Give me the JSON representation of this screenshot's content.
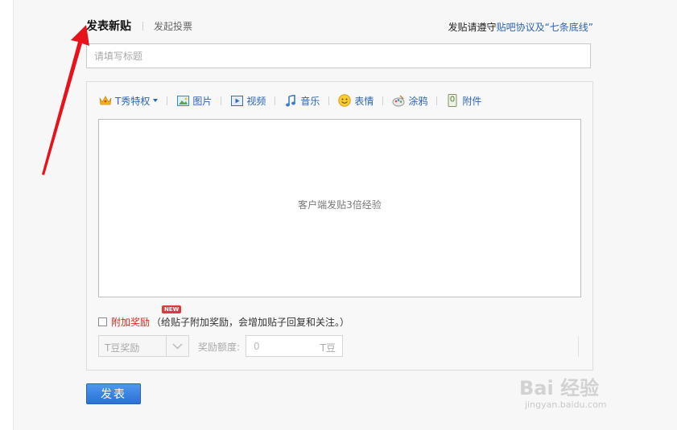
{
  "tabs": {
    "new_post": "发表新贴",
    "start_vote": "发起投票"
  },
  "rules": {
    "prefix": "发贴请遵守",
    "link_text": "贴吧协议及“七条底线”"
  },
  "title_input": {
    "placeholder": "请填写标题",
    "value": ""
  },
  "toolbar": {
    "items": [
      {
        "label": "T秀特权",
        "icon": "crown-icon"
      },
      {
        "label": "图片",
        "icon": "picture-icon"
      },
      {
        "label": "视频",
        "icon": "video-icon"
      },
      {
        "label": "音乐",
        "icon": "music-note-icon"
      },
      {
        "label": "表情",
        "icon": "smiley-icon"
      },
      {
        "label": "涂鸦",
        "icon": "graffiti-icon"
      },
      {
        "label": "附件",
        "icon": "attachment-icon"
      }
    ]
  },
  "editor": {
    "hint": "客户端发贴3倍经验"
  },
  "reward": {
    "label": "附加奖励",
    "badge": "NEW",
    "description": "（给贴子附加奖励，会增加贴子回复和关注。）",
    "type_select": "T豆奖励",
    "amount_label": "奖励额度:",
    "amount_value": "0",
    "amount_unit": "T豆"
  },
  "submit": {
    "label": "发表"
  },
  "watermark": {
    "text": "Bai  经验",
    "url": "jingyan.baidu.com"
  },
  "colors": {
    "link": "#2d64b3",
    "reward_red": "#d32b1e",
    "button_blue": "#2a72d6",
    "arrow_red": "#e8121a"
  }
}
